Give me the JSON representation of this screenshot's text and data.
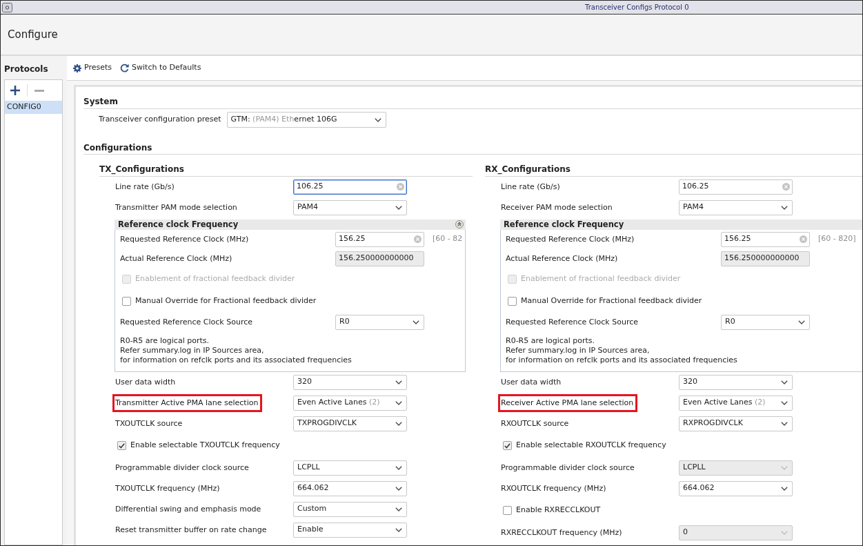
{
  "window": {
    "title": "Transceiver Configs Protocol 0"
  },
  "header": {
    "title": "Configure"
  },
  "sidebar": {
    "title": "Protocols",
    "actions": [
      {
        "kind": "add",
        "disabled": false
      },
      {
        "kind": "remove",
        "disabled": true
      }
    ],
    "items": [
      {
        "label": "CONFIG0",
        "selected": true
      }
    ]
  },
  "toolbar": [
    {
      "kind": "presets",
      "label": "Presets"
    },
    {
      "kind": "defaults",
      "label": "Switch to Defaults"
    }
  ],
  "system": {
    "title": "System",
    "rows": [
      {
        "kind": "select",
        "label": "Transceiver configuration preset",
        "parts": [
          {
            "text": "GTM: ",
            "muted": false
          },
          {
            "text": "(PAM4) Eth",
            "muted": true
          },
          {
            "text": "ernet 106G",
            "muted": false
          }
        ],
        "disabled": false,
        "highlighted": false
      }
    ]
  },
  "configurations": {
    "title": "Configurations",
    "columns": [
      {
        "title": "TX_Configurations",
        "rows": [
          {
            "kind": "text",
            "label": "Line rate (Gb/s)",
            "value": "106.25",
            "focused": true
          },
          {
            "kind": "select",
            "label": "Transmitter PAM mode selection",
            "value": "PAM4",
            "disabled": false,
            "highlighted": false
          },
          {
            "kind": "group",
            "title": "Reference clock Frequency",
            "expanded": true,
            "rows": [
              {
                "kind": "text",
                "label": "Requested Reference Clock (MHz)",
                "value": "156.25",
                "focused": false,
                "range": "[60 - 82"
              },
              {
                "kind": "readonly",
                "label": "Actual Reference Clock (MHz)",
                "value": "156.250000000000"
              },
              {
                "kind": "checkbox",
                "label": "Enablement of fractional feedback divider",
                "checked": false,
                "disabled": true
              },
              {
                "kind": "checkbox",
                "label": "Manual Override for Fractional feedback divider",
                "checked": false,
                "disabled": false
              },
              {
                "kind": "select",
                "label": "Requested Reference Clock Source",
                "value": "R0",
                "disabled": false,
                "highlighted": false
              },
              {
                "kind": "note",
                "lines": [
                  "R0-R5 are logical ports.",
                  "Refer summary.log in IP Sources area,",
                  "for information on refclk ports and its associated frequencies"
                ]
              }
            ]
          },
          {
            "kind": "select",
            "label": "User data width",
            "value": "320",
            "disabled": false,
            "highlighted": false
          },
          {
            "kind": "select",
            "label": "Transmitter Active PMA lane selection",
            "parts": [
              {
                "text": "Even Active Lanes ",
                "muted": false
              },
              {
                "text": "(2)",
                "muted": true
              }
            ],
            "disabled": false,
            "highlighted": true
          },
          {
            "kind": "select",
            "label": "TXOUTCLK source",
            "value": "TXPROGDIVCLK",
            "disabled": false,
            "highlighted": false
          },
          {
            "kind": "checkbox",
            "label": "Enable selectable TXOUTCLK frequency",
            "checked": true,
            "disabled": false
          },
          {
            "kind": "select",
            "label": "Programmable divider clock source",
            "value": "LCPLL",
            "disabled": false,
            "highlighted": false
          },
          {
            "kind": "select",
            "label": "TXOUTCLK frequency (MHz)",
            "value": "664.062",
            "disabled": false,
            "highlighted": false
          },
          {
            "kind": "select",
            "label": "Differential swing and emphasis mode",
            "value": "Custom",
            "disabled": false,
            "highlighted": false
          },
          {
            "kind": "select",
            "label": "Reset transmitter buffer on rate change",
            "value": "Enable",
            "disabled": false,
            "highlighted": false
          }
        ]
      },
      {
        "title": "RX_Configurations",
        "rows": [
          {
            "kind": "text",
            "label": "Line rate (Gb/s)",
            "value": "106.25",
            "focused": false
          },
          {
            "kind": "select",
            "label": "Receiver PAM mode selection",
            "value": "PAM4",
            "disabled": false,
            "highlighted": false
          },
          {
            "kind": "group",
            "title": "Reference clock Frequency",
            "rows": [
              {
                "kind": "text",
                "label": "Requested Reference Clock (MHz)",
                "value": "156.25",
                "focused": false,
                "range": "[60 - 820]"
              },
              {
                "kind": "readonly",
                "label": "Actual Reference Clock (MHz)",
                "value": "156.250000000000"
              },
              {
                "kind": "checkbox",
                "label": "Enablement of fractional feedback divider",
                "checked": false,
                "disabled": true
              },
              {
                "kind": "checkbox",
                "label": "Manual Override for Fractional feedback divider",
                "checked": false,
                "disabled": false
              },
              {
                "kind": "select",
                "label": "Requested Reference Clock Source",
                "value": "R0",
                "disabled": false,
                "highlighted": false
              },
              {
                "kind": "note",
                "lines": [
                  "R0-R5 are logical ports.",
                  "Refer summary.log in IP Sources area,",
                  "for information on refclk ports and its associated frequencies"
                ]
              }
            ]
          },
          {
            "kind": "select",
            "label": "User data width",
            "value": "320",
            "disabled": false,
            "highlighted": false
          },
          {
            "kind": "select",
            "label": "Receiver Active PMA lane selection",
            "parts": [
              {
                "text": "Even Active Lanes ",
                "muted": false
              },
              {
                "text": "(2)",
                "muted": true
              }
            ],
            "disabled": false,
            "highlighted": true
          },
          {
            "kind": "select",
            "label": "RXOUTCLK source",
            "value": "RXPROGDIVCLK",
            "disabled": false,
            "highlighted": false
          },
          {
            "kind": "checkbox",
            "label": "Enable selectable RXOUTCLK frequency",
            "checked": true,
            "disabled": false
          },
          {
            "kind": "select",
            "label": "Programmable divider clock source",
            "value": "LCPLL",
            "disabled": true,
            "highlighted": false
          },
          {
            "kind": "select",
            "label": "RXOUTCLK frequency (MHz)",
            "value": "664.062",
            "disabled": false,
            "highlighted": false
          },
          {
            "kind": "checkbox",
            "label": "Enable RXRECCLKOUT",
            "checked": false,
            "disabled": false
          },
          {
            "kind": "select",
            "label": "RXRECCLKOUT frequency (MHz)",
            "value": "0",
            "disabled": true,
            "highlighted": false
          }
        ]
      }
    ]
  }
}
